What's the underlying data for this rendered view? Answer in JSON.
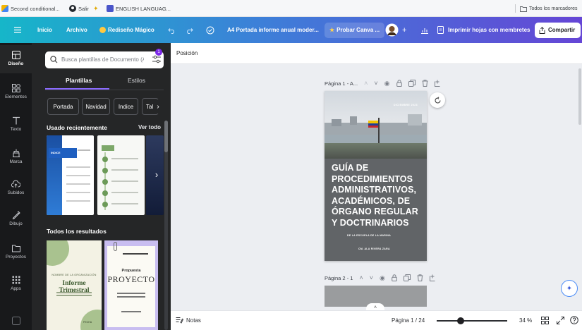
{
  "bookmarks": {
    "items": [
      "Second conditional...",
      "Salir",
      "ENGLISH LANGUAG..."
    ],
    "right": "Todos los marcadores"
  },
  "topbar": {
    "inicio": "Inicio",
    "archivo": "Archivo",
    "redisenio": "Rediseño Mágico",
    "doc_title": "A4 Portada informe anual moder...",
    "probar": "Probar Canva ...",
    "imprimir": "Imprimir hojas con membretes",
    "compartir": "Compartir"
  },
  "rail": {
    "items": [
      "Diseño",
      "Elementos",
      "Texto",
      "Marca",
      "Subidos",
      "Dibujo",
      "Proyectos",
      "Apps"
    ]
  },
  "panel": {
    "search_placeholder": "Busca plantillas de Documento (A4)",
    "tabs": [
      "Plantillas",
      "Estilos"
    ],
    "chips": [
      "Portada",
      "Navidad",
      "Indice",
      "Tal"
    ],
    "recent_title": "Usado recientemente",
    "see_all": "Ver todo",
    "results_title": "Todos los resultados",
    "t1": {
      "small": "INDICE"
    },
    "t3": {
      "org": "NOMBRE DE LA ORGANIZACIÓN",
      "title": "Informe Trimestral",
      "foot": "FECHA"
    },
    "t4": {
      "top": "Propuesta",
      "title": "PROYECTO"
    }
  },
  "editor": {
    "posicion": "Posición",
    "page1_label": "Página 1 - A...",
    "page2_label": "Página 2 - 1",
    "doc": {
      "date": "DICIEMBRE 2023",
      "line1": "GUÍA DE",
      "line2": "PROCEDIMIENTOS",
      "line3": "ADMINISTRATIVOS,",
      "line4": "ACADÉMICOS, DE",
      "line5": "ÓRGANO REGULAR",
      "line6": "Y DOCTRINARIOS",
      "sub": "DE LA ESCUELA DE LA MARINA",
      "author": "CM. ALA RIVERA ZARA"
    }
  },
  "status": {
    "notas": "Notas",
    "pagina": "Página 1 / 24",
    "zoom": "34 %",
    "zoom_level": 0.34
  }
}
